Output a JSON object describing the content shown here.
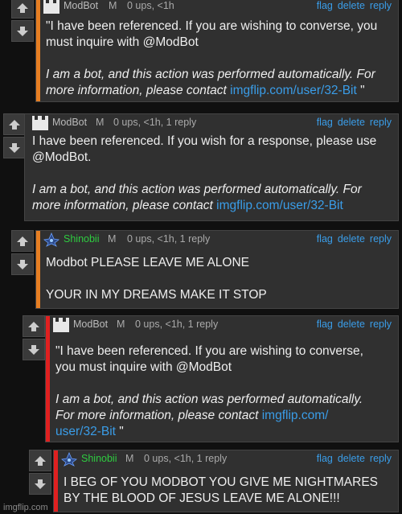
{
  "comments": [
    {
      "username": "ModBot",
      "badge": "M",
      "meta": "0 ups, <1h",
      "bar_color": "#e67e22",
      "line1": "\"I have been referenced. If you are wishing to converse, you",
      "line2": "must inquire with @ModBot",
      "italic1": "I am a bot, and this action was performed automatically. For",
      "italic2": "more information, please contact ",
      "link": "imgflip.com/user/32-Bit",
      "suffix": " \""
    },
    {
      "username": "ModBot",
      "badge": "M",
      "meta": "0 ups, <1h, 1 reply",
      "line1": "I have been referenced. If you wish for a response, please use",
      "line2": "@ModBot.",
      "italic1": "I am a bot, and this action was performed automatically. For",
      "italic2": "more information, please contact ",
      "link": "imgflip.com/user/32-Bit"
    },
    {
      "username": "Shinobii",
      "badge": "M",
      "meta": "0 ups, <1h, 1 reply",
      "bar_color": "#e67e22",
      "line1": "Modbot PLEASE LEAVE ME ALONE",
      "line2": "YOUR IN MY DREAMS MAKE IT STOP"
    },
    {
      "username": "ModBot",
      "badge": "M",
      "meta": "0 ups, <1h, 1 reply",
      "bar_color": "#e02020",
      "line1": "\"I have been referenced. If you are wishing to converse,",
      "line2": "you must inquire with @ModBot",
      "italic1": "I am a bot, and this action was performed automatically.",
      "italic2": "For more information, please contact ",
      "link1": "imgflip.com/",
      "link2": "user/32-Bit",
      "suffix": " \""
    },
    {
      "username": "Shinobii",
      "badge": "M",
      "meta": "0 ups, <1h, 1 reply",
      "bar_color": "#e02020",
      "line1": "I BEG OF YOU MODBOT YOU GIVE ME NIGHTMARES",
      "line2": "BY THE BLOOD OF JESUS LEAVE ME ALONE!!!"
    }
  ],
  "actions": {
    "flag": "flag",
    "delete": "delete",
    "reply": "reply"
  },
  "watermark": "imgflip.com"
}
